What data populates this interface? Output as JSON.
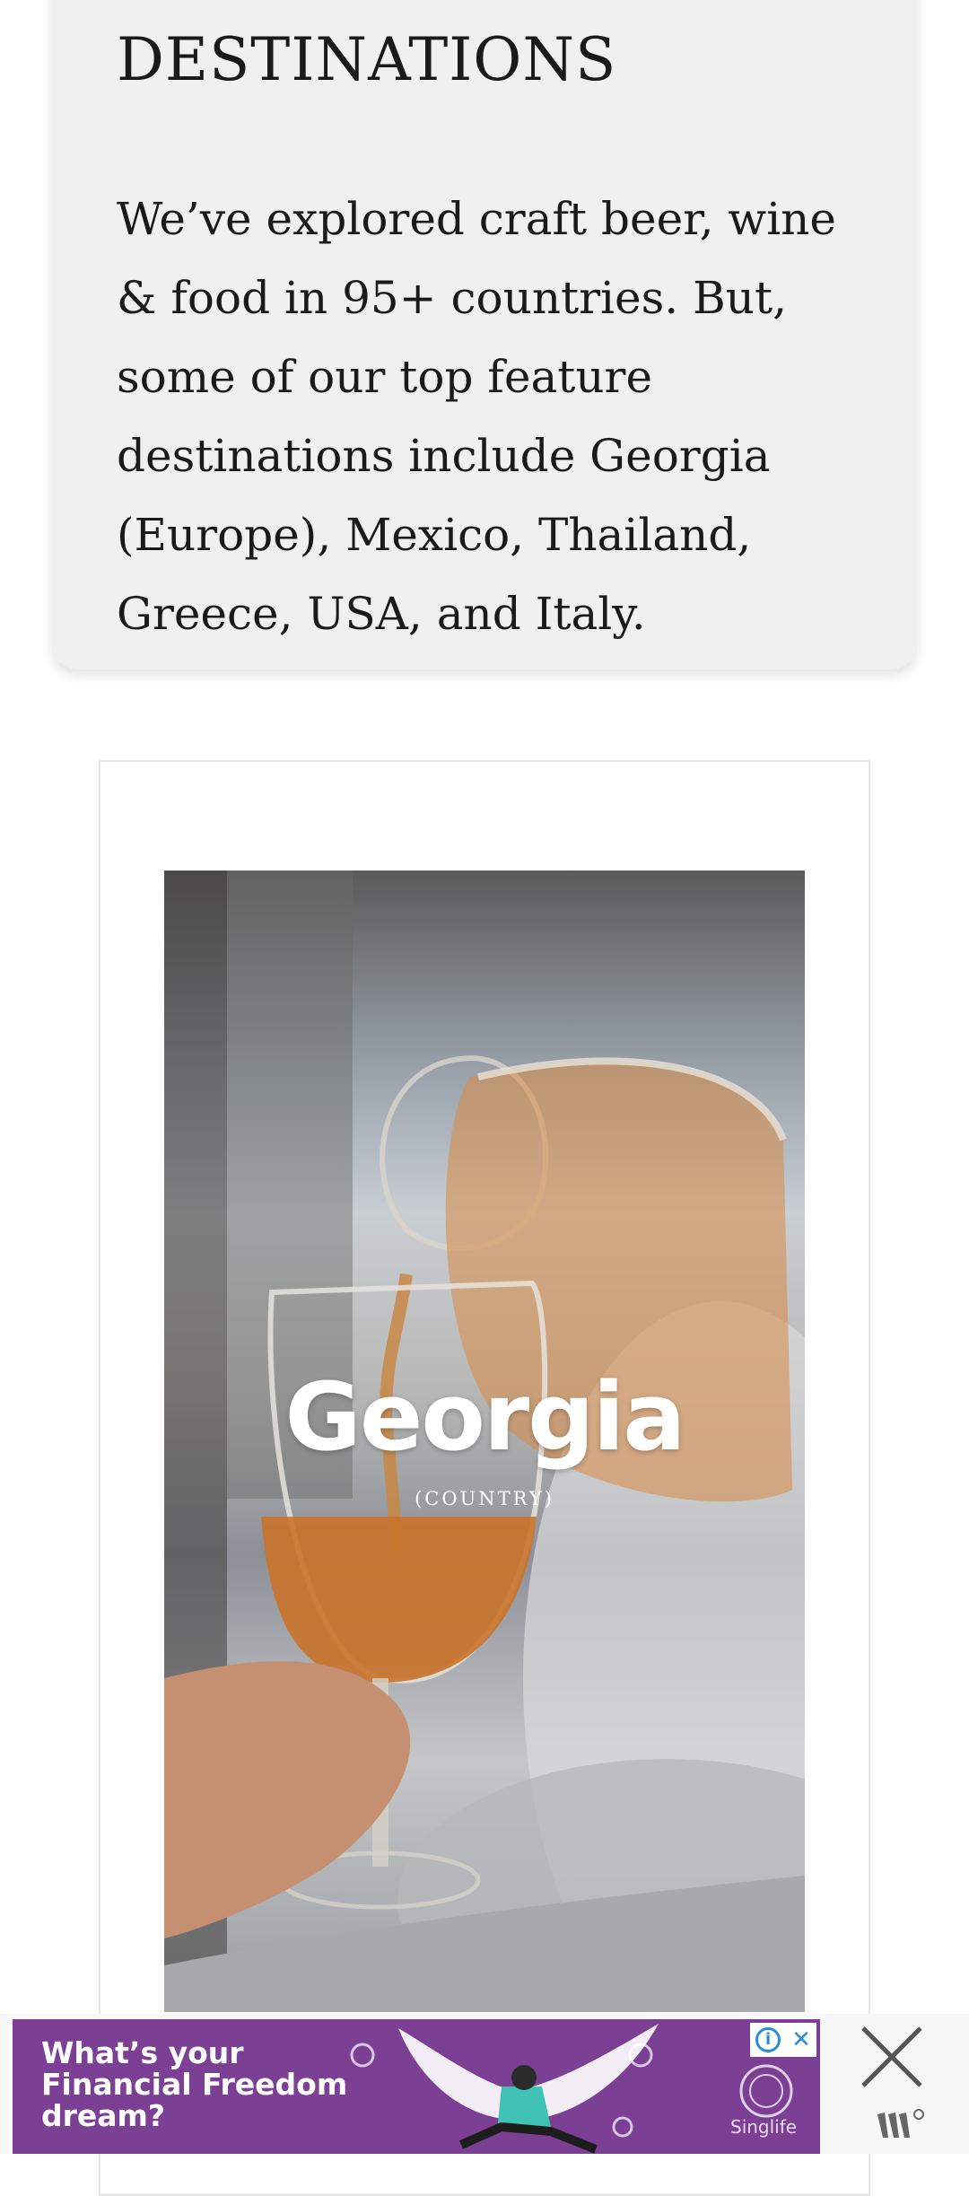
{
  "destinations_card": {
    "title": "DESTINATIONS",
    "body": "We’ve explored craft beer, wine & food in 95+ countries. But, some of our top feature destinations include Georgia (Europe), Mexico, Thailand, Greece, USA, and Italy."
  },
  "feature_image": {
    "title": "Georgia",
    "subtitle": "(COUNTRY)"
  },
  "ad": {
    "headline": "What’s your Financial Freedom dream?",
    "brand": "Singlife",
    "info_icon": "info-icon",
    "close_icon": "close-icon",
    "colors": {
      "banner": "#7b3f93",
      "accent": "#2d8cd6"
    }
  }
}
